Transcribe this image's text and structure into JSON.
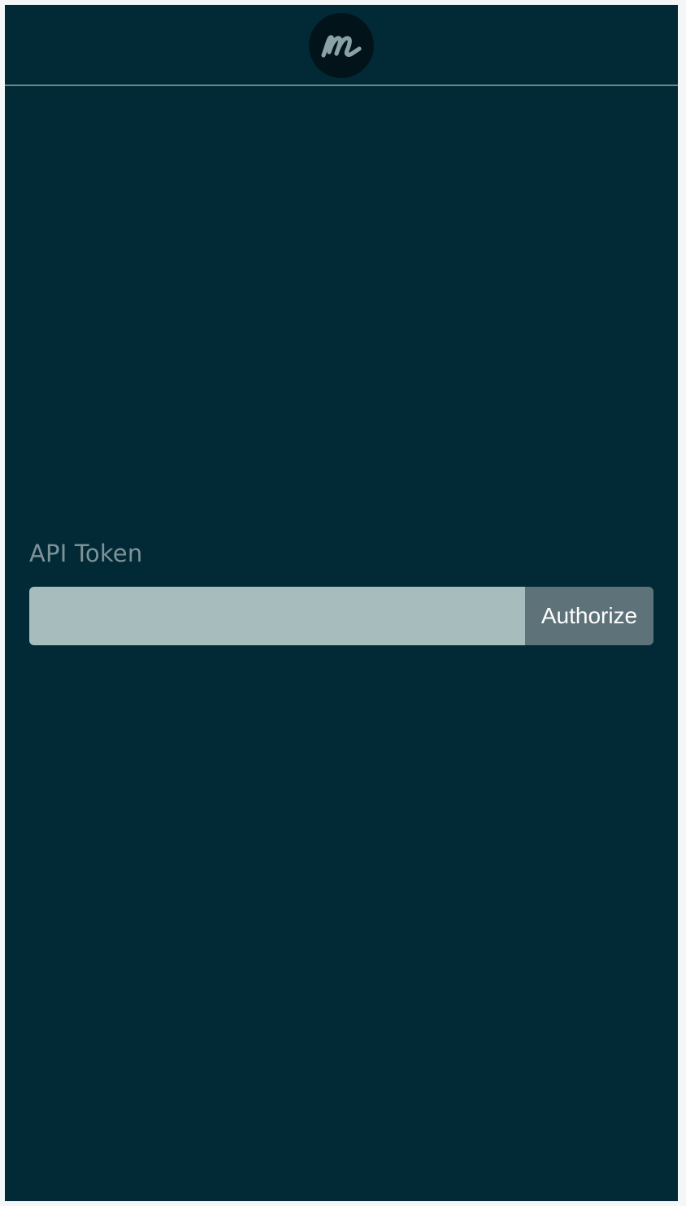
{
  "header": {
    "logo_icon": "m-logo-icon"
  },
  "form": {
    "label": "API Token",
    "input_value": "",
    "input_placeholder": "",
    "button_label": "Authorize"
  },
  "colors": {
    "background": "#012a36",
    "logo_bg": "#02141a",
    "logo_glyph": "#8aa1a6",
    "label": "#7e9399",
    "input_bg": "#a7bcbc",
    "button_bg": "#5e7279",
    "button_text": "#ffffff"
  }
}
